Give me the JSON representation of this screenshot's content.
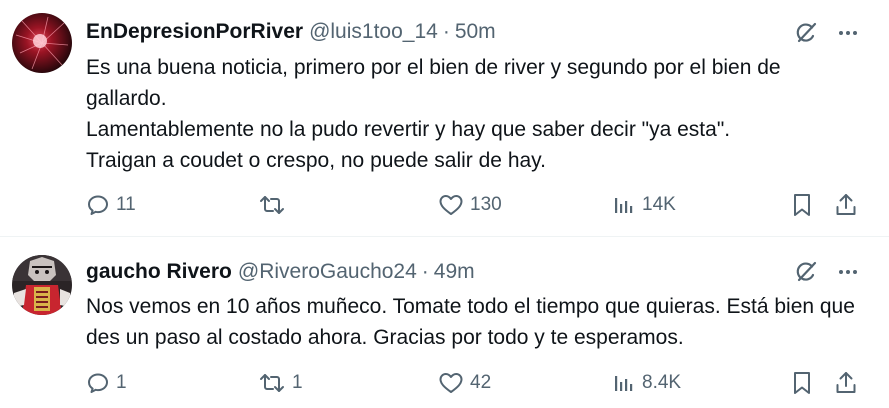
{
  "tweets": [
    {
      "display_name": "EnDepresionPorRiver",
      "handle": "@luis1too_14",
      "separator": "·",
      "time": "50m",
      "text_lines": [
        "Es una buena noticia, primero por el bien de river y segundo por el bien de gallardo.",
        "Lamentablemente no la pudo revertir y hay que saber decir \"ya esta\".",
        "Traigan a coudet o crespo, no puede salir de hay."
      ],
      "stats": {
        "replies": "11",
        "reposts": "",
        "likes": "130",
        "views": "14K"
      }
    },
    {
      "display_name": "gaucho Rivero",
      "handle": "@RiveroGaucho24",
      "separator": "·",
      "time": "49m",
      "text_lines": [
        "Nos vemos en 10 años muñeco. Tomate todo el tiempo que quieras. Está bien que des un paso al costado ahora. Gracias por todo y te esperamos."
      ],
      "stats": {
        "replies": "1",
        "reposts": "1",
        "likes": "42",
        "views": "8.4K"
      }
    }
  ],
  "icons": {
    "grok": "grok-icon",
    "more": "more-icon",
    "reply": "reply-icon",
    "repost": "repost-icon",
    "like": "heart-icon",
    "views": "views-icon",
    "bookmark": "bookmark-icon",
    "share": "share-icon"
  },
  "colors": {
    "text": "#0f1419",
    "secondary": "#536471",
    "divider": "#eff3f4"
  }
}
